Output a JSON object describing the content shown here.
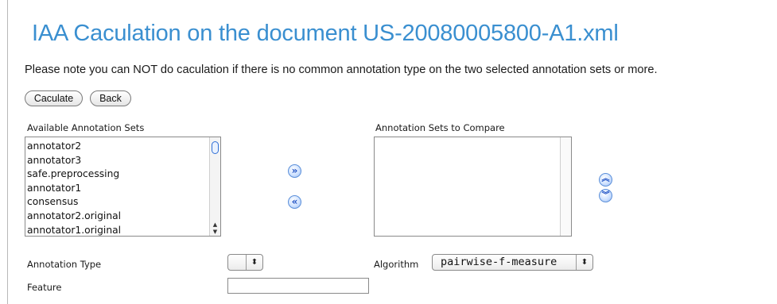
{
  "page": {
    "title": "IAA Caculation on the document US-20080005800-A1.xml",
    "note": "Please note you can NOT do caculation if there is no common annotation type on the two selected annotation sets or more."
  },
  "buttons": {
    "calculate": "Caculate",
    "back": "Back"
  },
  "available_sets": {
    "label": "Available Annotation Sets",
    "items": [
      "annotator2",
      "annotator3",
      "safe.preprocessing",
      "annotator1",
      "consensus",
      "annotator2.original",
      "annotator1.original"
    ]
  },
  "compare_sets": {
    "label": "Annotation Sets to Compare",
    "items": []
  },
  "controls": {
    "add_icon": "double-chevron-right-icon",
    "remove_icon": "double-chevron-left-icon",
    "move_up_icon": "double-chevron-up-icon",
    "move_down_icon": "double-chevron-down-icon"
  },
  "form": {
    "annotation_type_label": "Annotation Type",
    "annotation_type_value": "",
    "algorithm_label": "Algorithm",
    "algorithm_value": "pairwise-f-measure",
    "feature_label": "Feature",
    "feature_value": ""
  },
  "colors": {
    "title": "#3a8fd0",
    "icon_blue": "#1b4fc4"
  }
}
